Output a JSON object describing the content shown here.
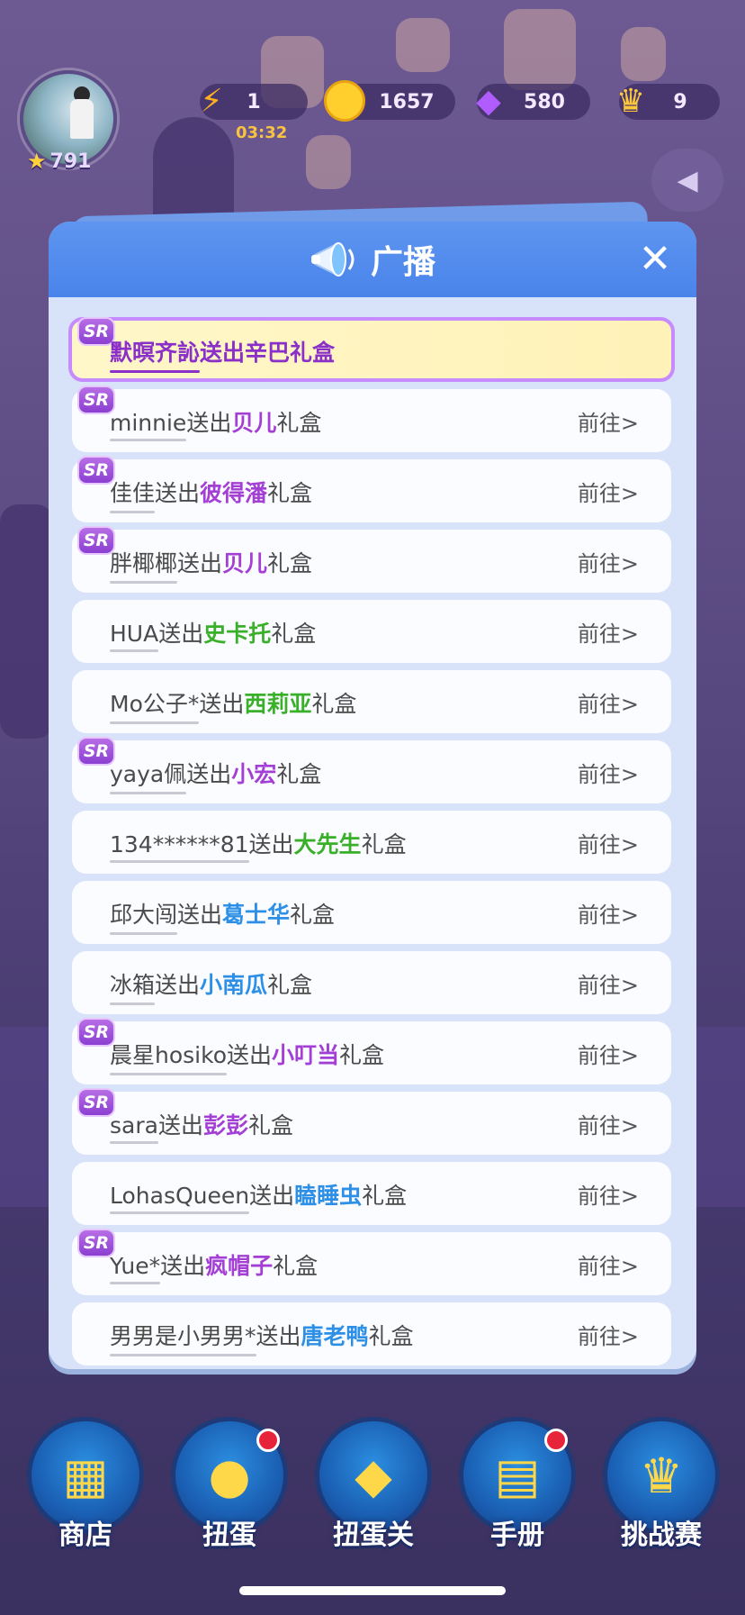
{
  "status": {
    "level": "791",
    "energy": "1",
    "timer": "03:32",
    "coins": "1657",
    "gems": "580",
    "crowns": "9"
  },
  "modal": {
    "title": "广播",
    "close": "✕",
    "go_label": "前往>",
    "sr_label": "SR",
    "featured": {
      "sender": "默暝齐訫",
      "action": "送出",
      "gift": "辛巴",
      "suffix": "礼盒"
    },
    "items": [
      {
        "sender": "minnie",
        "action": "送出",
        "gift": "贝儿",
        "suffix": "礼盒",
        "sr": true,
        "color": "purple"
      },
      {
        "sender": "佳佳",
        "action": "送出",
        "gift": "彼得潘",
        "suffix": "礼盒",
        "sr": true,
        "color": "purple"
      },
      {
        "sender": "胖椰椰",
        "action": "送出",
        "gift": "贝儿",
        "suffix": "礼盒",
        "sr": true,
        "color": "purple"
      },
      {
        "sender": "HUA",
        "action": "送出",
        "gift": "史卡托",
        "suffix": "礼盒",
        "sr": false,
        "color": "green"
      },
      {
        "sender": "Mo公子*",
        "action": "送出",
        "gift": "西莉亚",
        "suffix": "礼盒",
        "sr": false,
        "color": "green"
      },
      {
        "sender": "yaya佩",
        "action": "送出",
        "gift": "小宏",
        "suffix": "礼盒",
        "sr": true,
        "color": "purple"
      },
      {
        "sender": "134******81",
        "action": "送出",
        "gift": "大先生",
        "suffix": "礼盒",
        "sr": false,
        "color": "green"
      },
      {
        "sender": "邱大闯",
        "action": "送出",
        "gift": "葛士华",
        "suffix": "礼盒",
        "sr": false,
        "color": "blue"
      },
      {
        "sender": "冰箱",
        "action": "送出",
        "gift": "小南瓜",
        "suffix": "礼盒",
        "sr": false,
        "color": "blue"
      },
      {
        "sender": "晨星hosiko",
        "action": "送出",
        "gift": "小叮当",
        "suffix": "礼盒",
        "sr": true,
        "color": "purple"
      },
      {
        "sender": "sara",
        "action": "送出",
        "gift": "彭彭",
        "suffix": "礼盒",
        "sr": true,
        "color": "purple"
      },
      {
        "sender": "LohasQueen",
        "action": "送出",
        "gift": "瞌睡虫",
        "suffix": "礼盒",
        "sr": false,
        "color": "blue"
      },
      {
        "sender": "Yue*",
        "action": "送出",
        "gift": "疯帽子",
        "suffix": "礼盒",
        "sr": true,
        "color": "purple"
      },
      {
        "sender": "男男是小男男*",
        "action": "送出",
        "gift": "唐老鸭",
        "suffix": "礼盒",
        "sr": false,
        "color": "blue"
      }
    ]
  },
  "nav": {
    "shop": "商店",
    "gacha": "扭蛋",
    "gacha_stage": "扭蛋关",
    "handbook": "手册",
    "challenge": "挑战赛"
  },
  "colors": {
    "purple": "#a33fd4",
    "green": "#3ab02a",
    "blue": "#2e8fe6",
    "header": "#4a84ea"
  }
}
